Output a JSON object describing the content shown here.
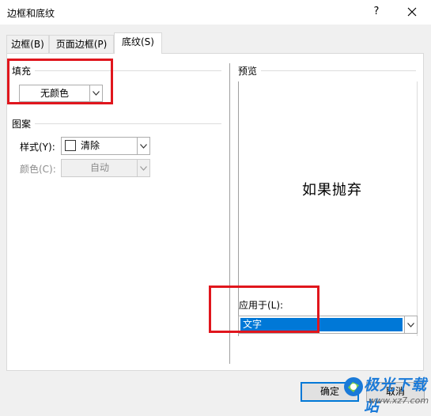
{
  "window": {
    "title": "边框和底纹",
    "help": "?",
    "close": "✕"
  },
  "tabs": [
    {
      "label": "边框(B)"
    },
    {
      "label": "页面边框(P)"
    },
    {
      "label": "底纹(S)"
    }
  ],
  "fill": {
    "section": "填充",
    "color_value": "无颜色"
  },
  "pattern": {
    "section": "图案",
    "style_label": "样式(Y):",
    "style_value": "清除",
    "color_label": "颜色(C):",
    "color_value": "自动"
  },
  "preview": {
    "section": "预览",
    "sample_text": "如果抛弃"
  },
  "apply_to": {
    "label": "应用于(L):",
    "value": "文字"
  },
  "buttons": {
    "ok": "确定",
    "cancel": "取消"
  },
  "watermark": {
    "text": "极光下载站",
    "url": "www.xz7.com"
  },
  "colors": {
    "highlight": "#0078d7",
    "annotation": "#e0161d",
    "watermark": "#1a7ad8"
  }
}
